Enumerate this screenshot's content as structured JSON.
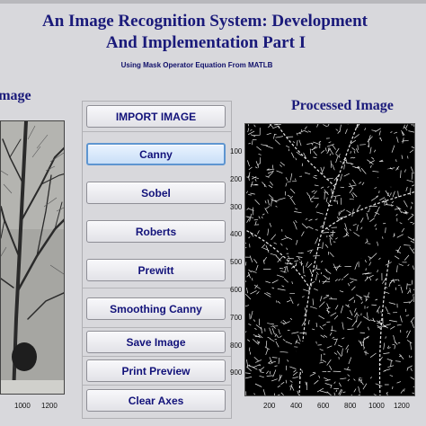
{
  "header": {
    "title_line1": "An Image Recognition System: Development",
    "title_line2": "And Implementation Part I",
    "subtitle": "Using Mask Operator Equation From MATLB"
  },
  "left_panel": {
    "label": "Image"
  },
  "right_panel": {
    "label": "Processed Image"
  },
  "buttons": {
    "import": "IMPORT IMAGE",
    "canny": "Canny",
    "sobel": "Sobel",
    "roberts": "Roberts",
    "prewitt": "Prewitt",
    "smoothing_canny": "Smoothing Canny",
    "save": "Save Image",
    "print_preview": "Print Preview",
    "clear_axes": "Clear Axes"
  },
  "right_axes": {
    "y_ticks": [
      "100",
      "200",
      "300",
      "400",
      "500",
      "600",
      "700",
      "800",
      "900"
    ],
    "x_ticks": [
      "200",
      "400",
      "600",
      "800",
      "1000",
      "1200"
    ]
  },
  "left_axes": {
    "x_ticks": [
      "1000",
      "1200"
    ]
  },
  "colors": {
    "title": "#1a1a7a",
    "button_text": "#12127a",
    "active_button_border": "#5e95d0",
    "background": "#d8d8dc"
  }
}
